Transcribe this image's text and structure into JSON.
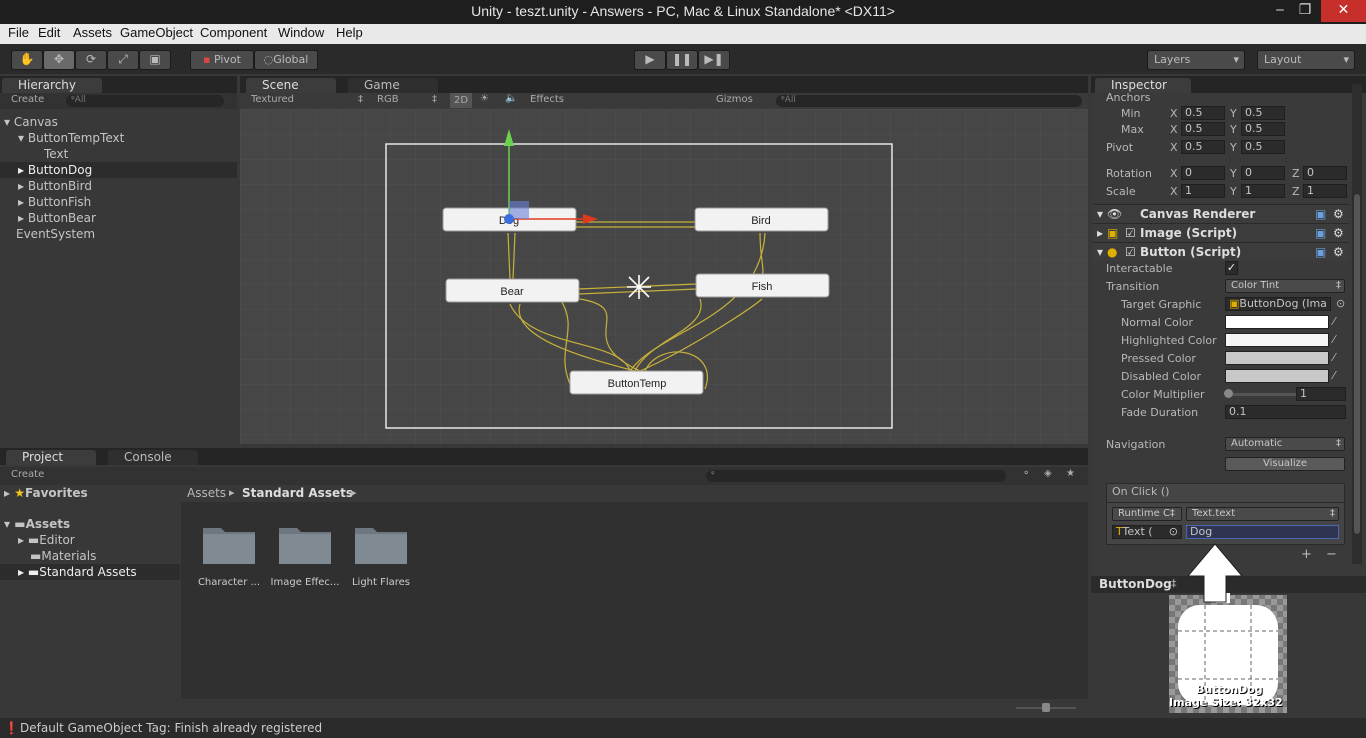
{
  "window": {
    "title": "Unity - teszt.unity - Answers - PC, Mac & Linux Standalone* <DX11>",
    "min": "‒",
    "max": "❐",
    "close": "✕"
  },
  "menu": [
    "File",
    "Edit",
    "Assets",
    "GameObject",
    "Component",
    "Window",
    "Help"
  ],
  "toolbar": {
    "pivot": "Pivot",
    "global": "Global",
    "layers": "Layers",
    "layout": "Layout"
  },
  "hierarchy": {
    "tab": "Hierarchy",
    "create": "Create",
    "search": "All",
    "items": [
      "Canvas",
      "ButtonTempText",
      "Text",
      "ButtonDog",
      "ButtonBird",
      "ButtonFish",
      "ButtonBear",
      "EventSystem"
    ]
  },
  "scene": {
    "tab_scene": "Scene",
    "tab_game": "Game",
    "shading": "Textured",
    "render": "RGB",
    "mode2d": "2D",
    "effects": "Effects",
    "gizmos": "Gizmos",
    "search": "All",
    "buttons": {
      "dog": "Dog",
      "bird": "Bird",
      "bear": "Bear",
      "fish": "Fish",
      "temp": "ButtonTemp"
    }
  },
  "project": {
    "tab_project": "Project",
    "tab_console": "Console",
    "create": "Create",
    "favorites": "Favorites",
    "assets": "Assets",
    "tree": [
      "Editor",
      "Materials",
      "Standard Assets"
    ],
    "breadcrumb": [
      "Assets",
      "Standard Assets"
    ],
    "folders": [
      "Character ...",
      "Image Effec...",
      "Light Flares"
    ]
  },
  "status": {
    "message": "Default GameObject Tag: Finish already registered"
  },
  "inspector": {
    "tab": "Inspector",
    "anchors": "Anchors",
    "min": {
      "label": "Min",
      "x": "0.5",
      "y": "0.5"
    },
    "max": {
      "label": "Max",
      "x": "0.5",
      "y": "0.5"
    },
    "pivot": {
      "label": "Pivot",
      "x": "0.5",
      "y": "0.5"
    },
    "rotation": {
      "label": "Rotation",
      "x": "0",
      "y": "0",
      "z": "0"
    },
    "scale": {
      "label": "Scale",
      "x": "1",
      "y": "1",
      "z": "1"
    },
    "axis": {
      "x": "X",
      "y": "Y",
      "z": "Z"
    },
    "components": {
      "canvas_renderer": "Canvas Renderer",
      "image": "Image (Script)",
      "button": "Button (Script)"
    },
    "interactable": "Interactable",
    "transition": {
      "label": "Transition",
      "value": "Color Tint"
    },
    "target_graphic": {
      "label": "Target Graphic",
      "value": "ButtonDog (Ima"
    },
    "colors": [
      "Normal Color",
      "Highlighted Color",
      "Pressed Color",
      "Disabled Color"
    ],
    "color_multiplier": {
      "label": "Color Multiplier",
      "value": "1"
    },
    "fade_duration": {
      "label": "Fade Duration",
      "value": "0.1"
    },
    "navigation": {
      "label": "Navigation",
      "value": "Automatic"
    },
    "visualize": "Visualize",
    "onclick": {
      "header": "On Click ()",
      "runtime": "Runtime C‡",
      "function": "Text.text",
      "object": "Text (",
      "arg": "Dog"
    },
    "plus": "+",
    "minus": "−"
  },
  "preview": {
    "name": "ButtonDog",
    "caption": "ButtonDog",
    "size": "Image Size: 32x32"
  }
}
